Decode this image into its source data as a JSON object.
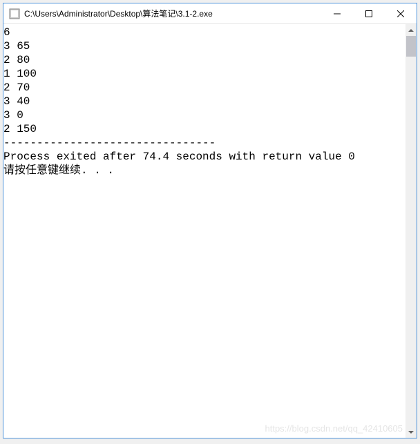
{
  "window": {
    "title": "C:\\Users\\Administrator\\Desktop\\算法笔记\\3.1-2.exe"
  },
  "console": {
    "lines": [
      "6",
      "3 65",
      "2 80",
      "1 100",
      "2 70",
      "3 40",
      "3 0",
      "2 150",
      "--------------------------------",
      "Process exited after 74.4 seconds with return value 0",
      "请按任意键继续. . ."
    ]
  },
  "watermark": "https://blog.csdn.net/qq_42410605"
}
